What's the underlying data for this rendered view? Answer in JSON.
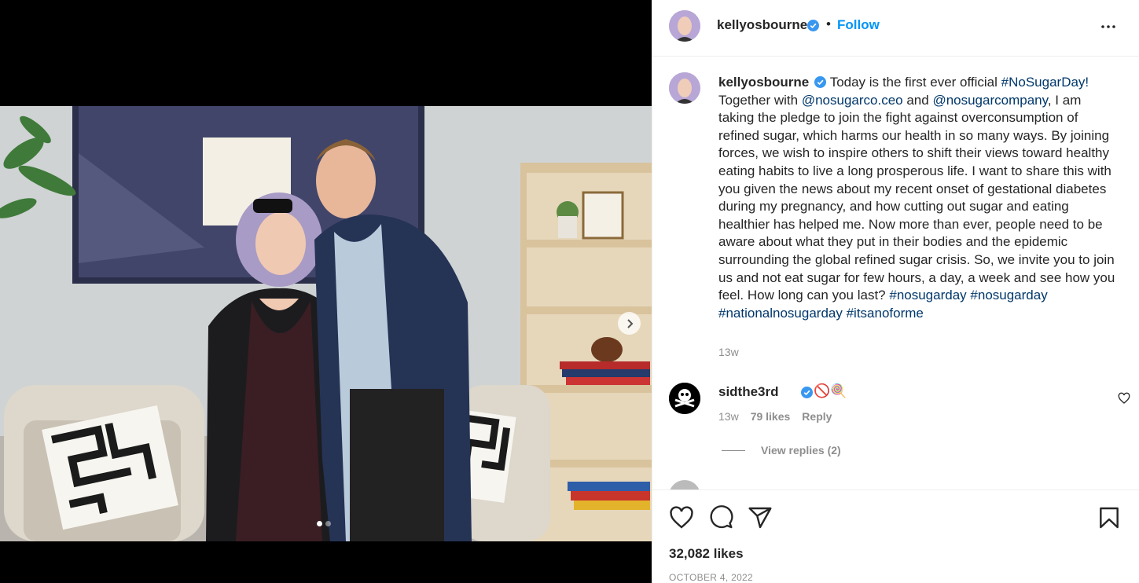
{
  "post": {
    "author": "kellyosbourne",
    "separator": "•",
    "follow_label": "Follow",
    "more_icon": "more-horizontal-icon",
    "caption_parts": [
      {
        "text": "Today is the first ever official ",
        "type": "text"
      },
      {
        "text": "#NoSugarDay!",
        "type": "link"
      },
      {
        "text": " Together with ",
        "type": "text"
      },
      {
        "text": "@nosugarco.ceo",
        "type": "link"
      },
      {
        "text": " and ",
        "type": "text"
      },
      {
        "text": "@nosugarcompany",
        "type": "link"
      },
      {
        "text": ", I am taking the pledge to join the fight against overconsumption of refined sugar, which harms our health in so many ways.  By joining forces, we wish to inspire others to shift their views toward healthy eating habits to live a long prosperous life.  I want to share this with you given the news about my recent onset of gestational diabetes during my pregnancy, and how cutting out sugar and eating healthier has helped me. Now more than ever, people need to be aware about what they put in their bodies and the epidemic surrounding the global refined sugar crisis. So, we invite you to join us and not eat sugar for few hours, a day, a week and see how you feel.  How long can you last?   ",
        "type": "text"
      },
      {
        "text": "#nosugarday",
        "type": "link"
      },
      {
        "text": " ",
        "type": "text"
      },
      {
        "text": "#nosugarday",
        "type": "link"
      },
      {
        "text": " ",
        "type": "text"
      },
      {
        "text": "#nationalnosugarday",
        "type": "link"
      },
      {
        "text": " ",
        "type": "text"
      },
      {
        "text": "#itsanoforme",
        "type": "link"
      }
    ],
    "caption_time": "13w",
    "likes": "32,082 likes",
    "date": "OCTOBER 4, 2022"
  },
  "comments": [
    {
      "user": "sidthe3rd",
      "text": "🚫🍭",
      "time": "13w",
      "likes": "79 likes",
      "reply_label": "Reply",
      "view_replies": "View replies (2)"
    }
  ],
  "media": {
    "slide_count": 2,
    "active_slide": 1
  },
  "colors": {
    "accent": "#0095f6",
    "link": "#00376b",
    "muted": "#8e8e8e",
    "verified": "#3897f0"
  }
}
